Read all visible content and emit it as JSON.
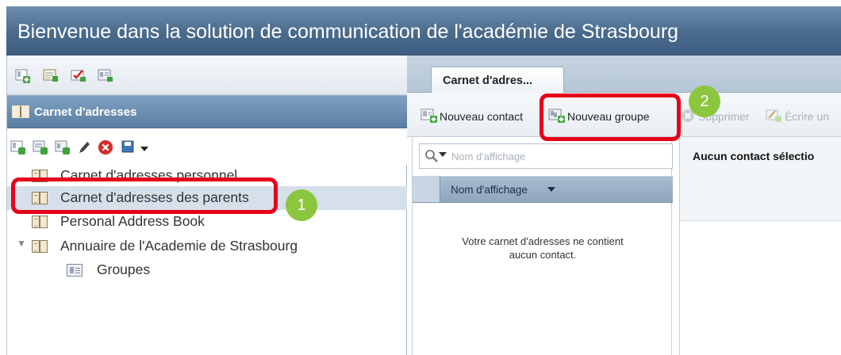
{
  "window": {
    "title": "Bienvenue dans la solution de communication de l'académie de Strasbourg"
  },
  "left_toolbar": {
    "icons": [
      "new-contact-icon",
      "compose-icon",
      "tasks-icon",
      "addressbook-icon"
    ]
  },
  "addressbook_panel": {
    "header_label": "Carnet d'adresses",
    "toolbar_icons": [
      "new-contact-icon",
      "new-list-icon",
      "new-group-icon",
      "edit-pencil-icon",
      "delete-icon",
      "save-dropdown-icon"
    ]
  },
  "tree": {
    "items": [
      {
        "label": "Carnet d'adresses personnel"
      },
      {
        "label": "Carnet d'adresses des parents"
      },
      {
        "label": "Personal Address Book"
      },
      {
        "label": "Annuaire de l'Academie de Strasbourg"
      },
      {
        "label": "Groupes"
      }
    ]
  },
  "tabs": [
    {
      "label": "Carnet d'adres..."
    }
  ],
  "toolbar": {
    "new_contact": "Nouveau contact",
    "new_group": "Nouveau groupe",
    "delete": "Supprimer",
    "write": "Écrire un"
  },
  "search": {
    "placeholder": "Nom d'affichage"
  },
  "list": {
    "column_header": "Nom d'affichage",
    "empty_message_line1": "Votre carnet d'adresses ne contient",
    "empty_message_line2": "aucun contact."
  },
  "detail": {
    "header": "Aucun contact sélectio"
  },
  "annotations": {
    "badge1": "1",
    "badge2": "2"
  },
  "colors": {
    "title_bar": "#4a6a8c",
    "header_blue": "#5a7ea2",
    "callout_red": "#e6001a",
    "badge_green": "#8cc63f",
    "selected_row": "#d6e0ea"
  }
}
